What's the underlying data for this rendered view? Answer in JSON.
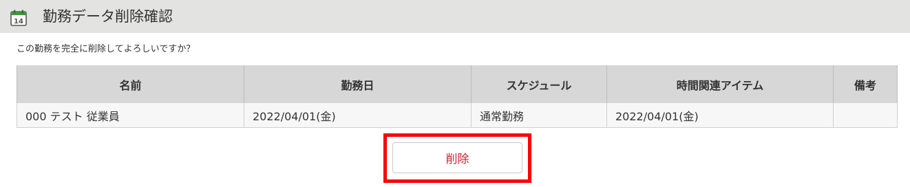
{
  "header": {
    "title": "勤務データ削除確認",
    "icon": "calendar-icon",
    "icon_day": "14",
    "icon_color": "#3a9b3a"
  },
  "prompt": "この勤務を完全に削除してよろしいですか？",
  "table": {
    "columns": [
      "名前",
      "勤務日",
      "スケジュール",
      "時間関連アイテム",
      "備考"
    ],
    "rows": [
      [
        "000 テスト 従業員",
        "2022/04/01(金)",
        "通常勤務",
        "2022/04/01(金)",
        ""
      ]
    ]
  },
  "actions": {
    "delete_label": "削除",
    "delete_color": "#d9232e",
    "highlight_color": "#ff0000"
  }
}
